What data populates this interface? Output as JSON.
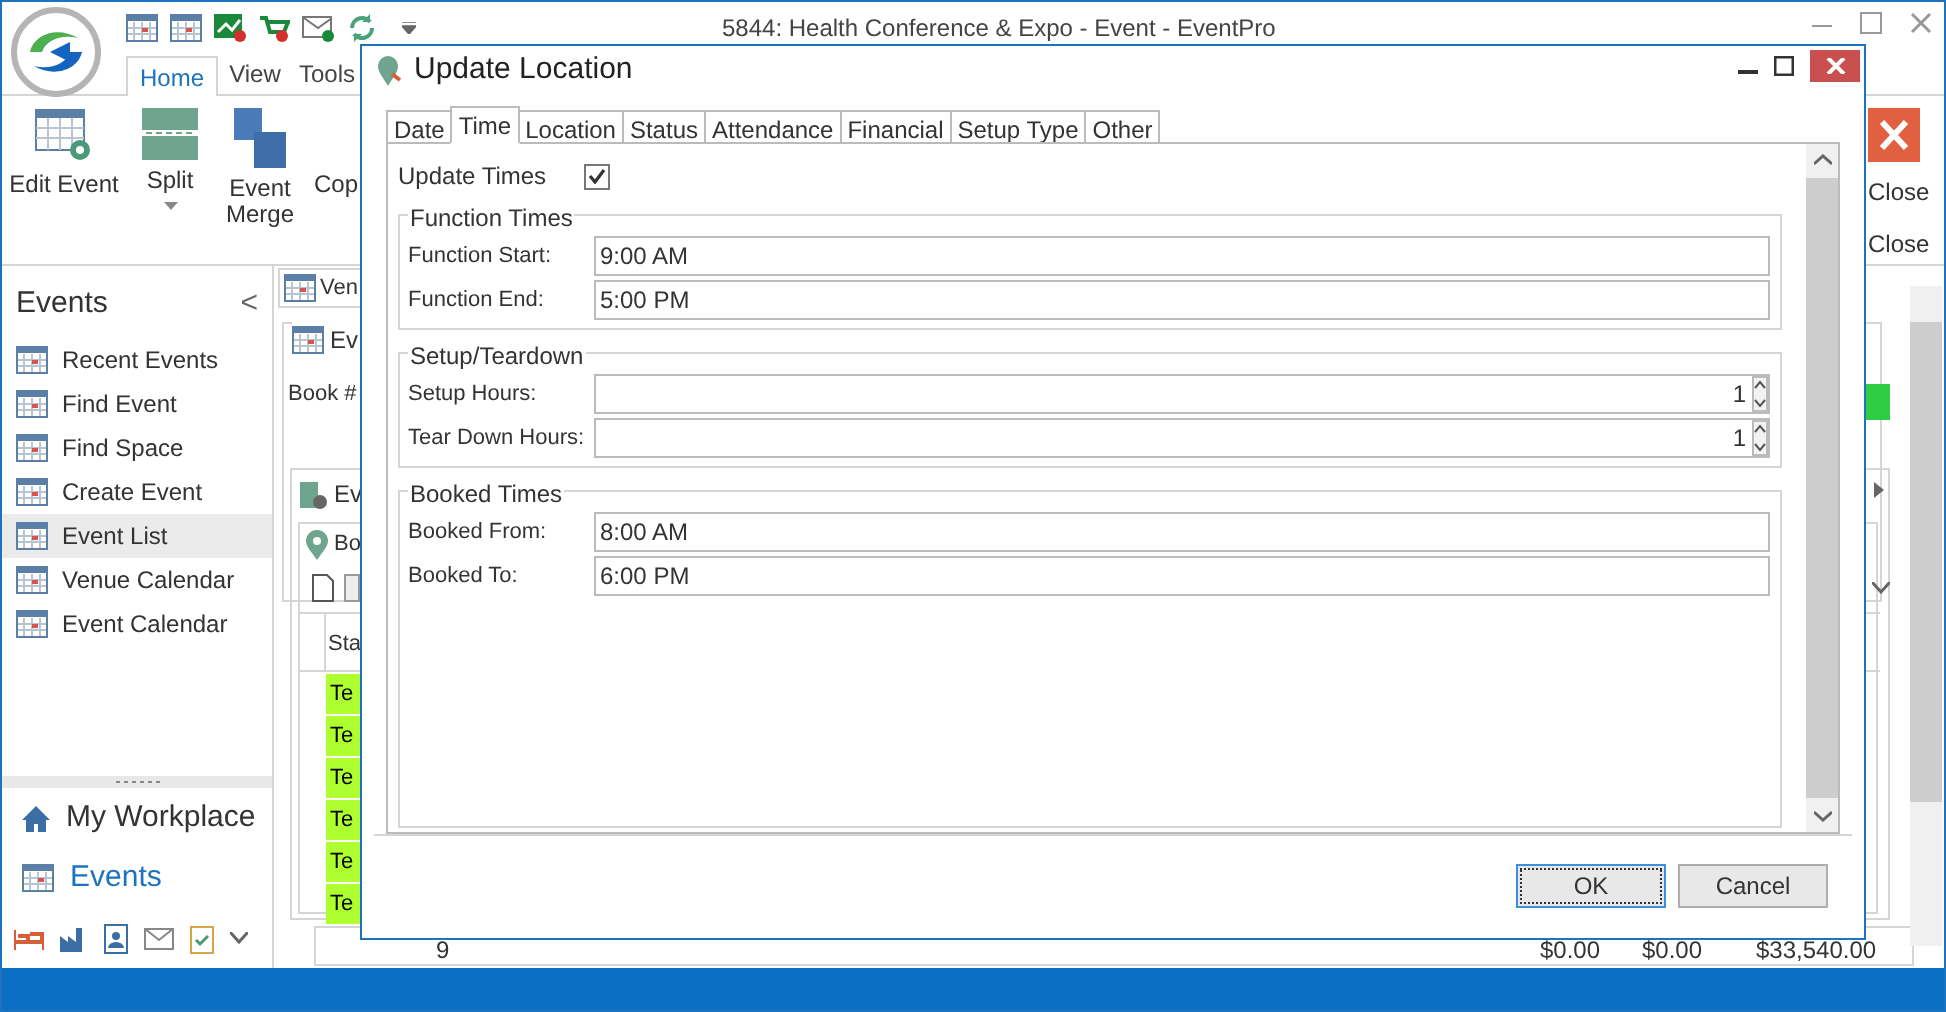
{
  "app_window": {
    "title": "5844: Health Conference & Expo - Event - EventPro"
  },
  "ribbon": {
    "tabs": [
      {
        "label": "Home",
        "selected": true
      },
      {
        "label": "View",
        "selected": false
      },
      {
        "label": "Tools",
        "selected": false
      }
    ],
    "buttons": [
      {
        "label": "Edit Event",
        "kind": "gear"
      },
      {
        "label": "Split",
        "kind": "split",
        "dropdown": true
      },
      {
        "label": "Event Merge",
        "kind": "merge"
      },
      {
        "label": "Cop",
        "kind": "none"
      }
    ],
    "close_buttons": [
      "Close",
      "Close"
    ]
  },
  "navigation": {
    "header": "Events",
    "collapse_glyph": "<",
    "items": [
      {
        "label": "Recent Events",
        "selected": false
      },
      {
        "label": "Find Event",
        "selected": false
      },
      {
        "label": "Find Space",
        "selected": false
      },
      {
        "label": "Create Event",
        "selected": false
      },
      {
        "label": "Event List",
        "selected": true
      },
      {
        "label": "Venue Calendar",
        "selected": false
      },
      {
        "label": "Event Calendar",
        "selected": false
      }
    ],
    "sections": [
      {
        "label": "My Workplace",
        "kind": "home",
        "selected": false
      },
      {
        "label": "Events",
        "kind": "calendar",
        "selected": true
      }
    ]
  },
  "background_content": {
    "tab": "Ven",
    "group_title": "Ev",
    "book_label": "Book #",
    "list_tab": "Ev",
    "location_label": "Bo",
    "column": "Sta",
    "rows": [
      "Te",
      "Te",
      "Te",
      "Te",
      "Te",
      "Te"
    ],
    "footer": {
      "count": "9",
      "values": [
        "$0.00",
        "$0.00",
        "$33,540.00"
      ]
    }
  },
  "dialog": {
    "title": "Update Location",
    "tabs": [
      {
        "label": "Date",
        "selected": false
      },
      {
        "label": "Time",
        "selected": true
      },
      {
        "label": "Location",
        "selected": false
      },
      {
        "label": "Status",
        "selected": false
      },
      {
        "label": "Attendance",
        "selected": false
      },
      {
        "label": "Financial",
        "selected": false
      },
      {
        "label": "Setup Type",
        "selected": false
      },
      {
        "label": "Other",
        "selected": false
      }
    ],
    "update_times": {
      "label": "Update Times",
      "checked": true
    },
    "groups": [
      {
        "title": "Function Times",
        "fields": [
          {
            "label": "Function Start:",
            "value": "9:00 AM",
            "kind": "text"
          },
          {
            "label": "Function End:",
            "value": "5:00 PM",
            "kind": "text"
          }
        ]
      },
      {
        "title": "Setup/Teardown",
        "fields": [
          {
            "label": "Setup Hours:",
            "value": "1",
            "kind": "spin"
          },
          {
            "label": "Tear Down Hours:",
            "value": "1",
            "kind": "spin"
          }
        ]
      },
      {
        "title": "Booked Times",
        "fields": [
          {
            "label": "Booked From:",
            "value": "8:00 AM",
            "kind": "text"
          },
          {
            "label": "Booked To:",
            "value": "6:00 PM",
            "kind": "text"
          }
        ]
      }
    ],
    "buttons": [
      {
        "label": "OK",
        "default": true
      },
      {
        "label": "Cancel",
        "default": false
      }
    ]
  }
}
